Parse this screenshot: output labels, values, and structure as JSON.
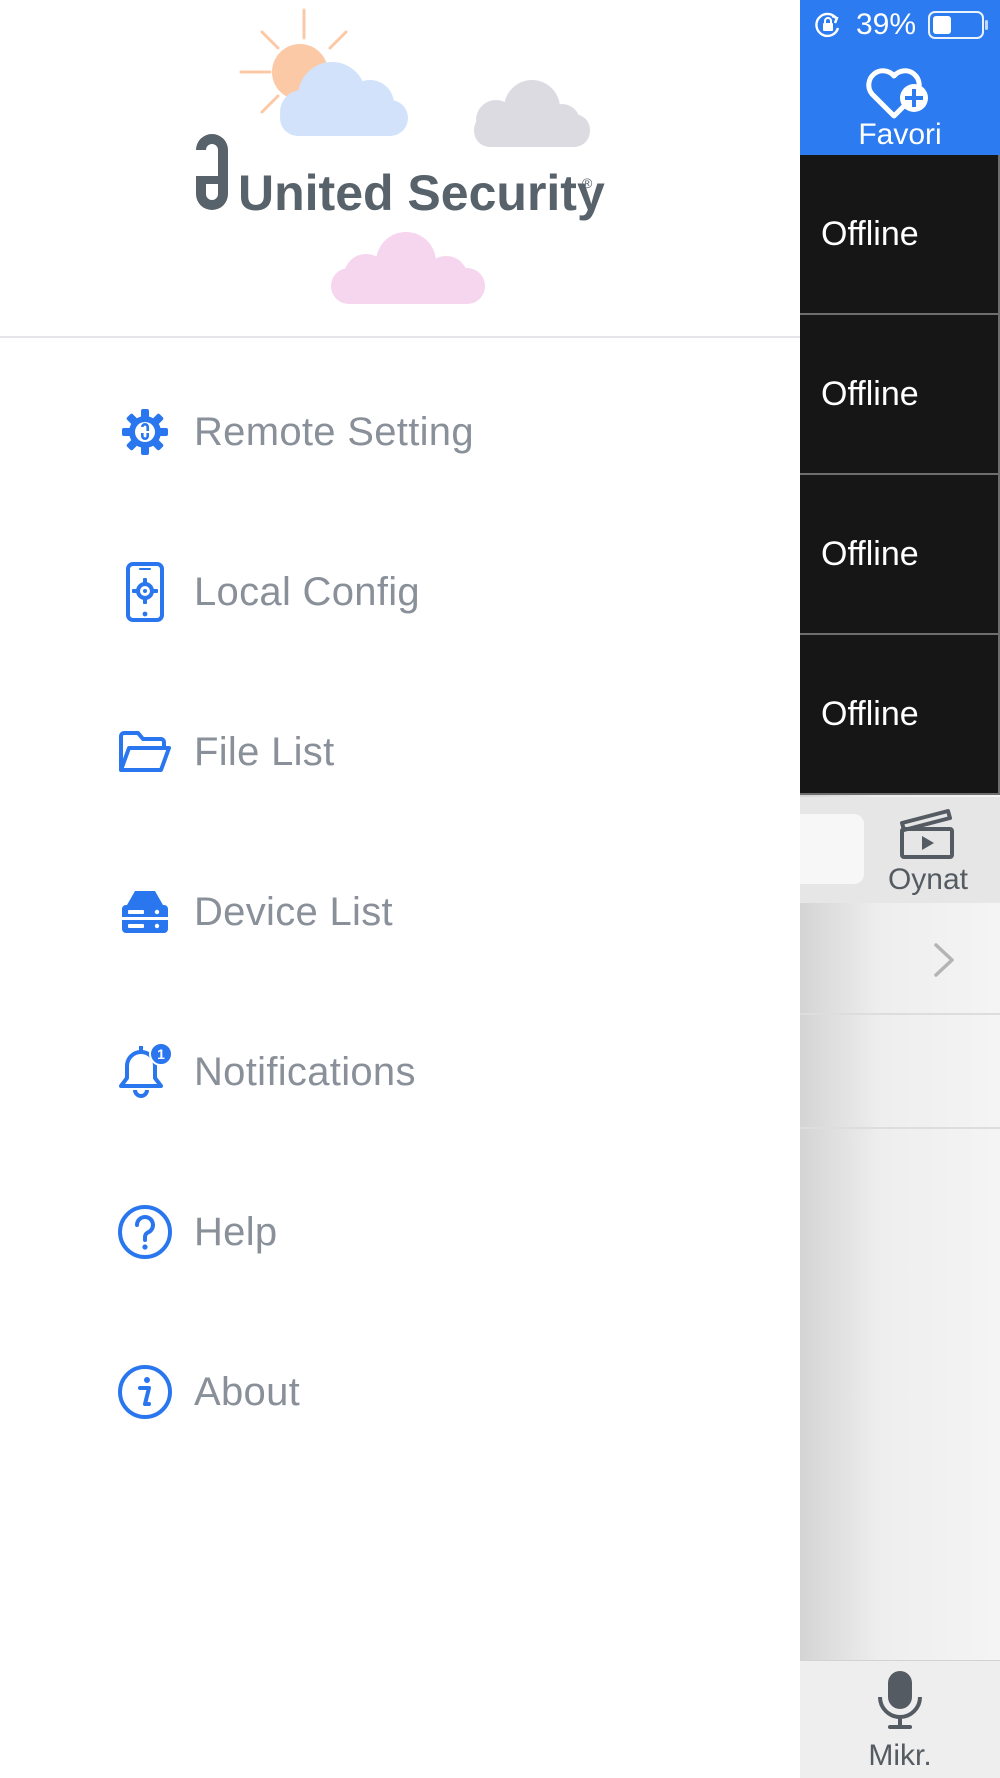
{
  "brand": {
    "name": "United Security",
    "registered_mark": "®",
    "text_color": "#58626b"
  },
  "colors": {
    "accent": "#2d7bf0",
    "icon_blue": "#2a76ee",
    "menu_text": "#8a9099",
    "tile_bg": "#161616"
  },
  "menu": {
    "items": [
      {
        "label": "Remote Setting",
        "icon": "remote-setting-gear-icon"
      },
      {
        "label": "Local Config",
        "icon": "phone-gear-icon"
      },
      {
        "label": "File List",
        "icon": "folder-icon"
      },
      {
        "label": "Device List",
        "icon": "device-server-icon"
      },
      {
        "label": "Notifications",
        "icon": "bell-icon",
        "badge": "1"
      },
      {
        "label": "Help",
        "icon": "question-circle-icon"
      },
      {
        "label": "About",
        "icon": "info-circle-icon"
      }
    ]
  },
  "status_bar": {
    "battery_percent": "39%",
    "battery_level": 0.39,
    "icons": [
      "rotation-lock-icon",
      "battery-icon"
    ]
  },
  "favorites": {
    "label": "Favori",
    "icon": "heart-plus-icon"
  },
  "channels": [
    {
      "status": "Offline"
    },
    {
      "status": "Offline"
    },
    {
      "status": "Offline"
    },
    {
      "status": "Offline"
    }
  ],
  "toolbar": {
    "play_label": "Oynat",
    "play_icon": "clapperboard-play-icon"
  },
  "bottom_bar": {
    "mic_label": "Mikr.",
    "mic_icon": "microphone-icon"
  }
}
